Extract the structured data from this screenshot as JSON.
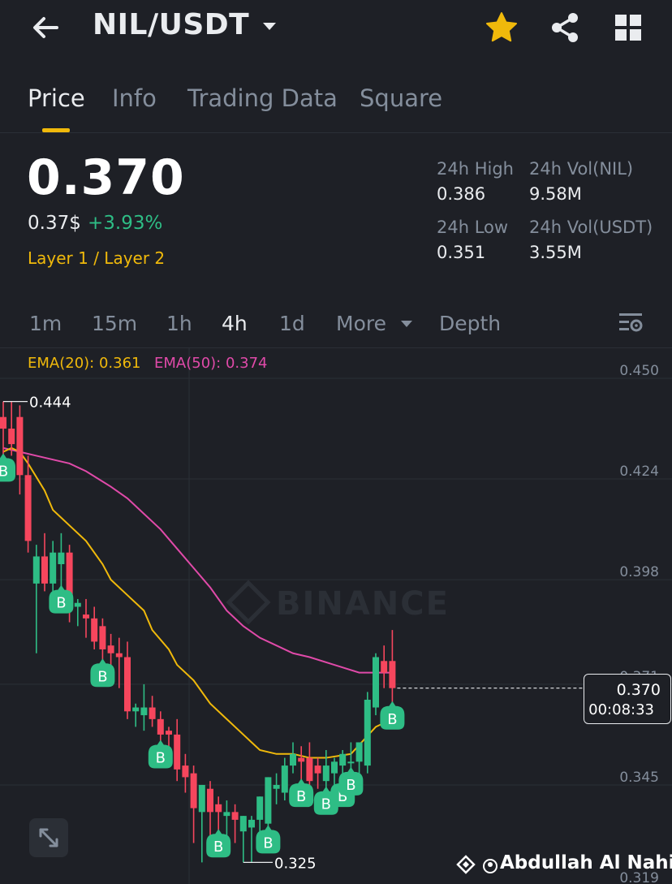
{
  "header": {
    "pair": "NIL/USDT",
    "icons": [
      "back-arrow-icon",
      "caret-down-icon",
      "star-icon",
      "share-icon",
      "grid-icon"
    ],
    "star_color": "#f0b90b"
  },
  "tabs": [
    {
      "label": "Price",
      "active": true
    },
    {
      "label": "Info",
      "active": false
    },
    {
      "label": "Trading Data",
      "active": false
    },
    {
      "label": "Square",
      "active": false
    }
  ],
  "price": {
    "last": "0.370",
    "usd": "0.37$",
    "change": "+3.93%",
    "category": "Layer 1 / Layer 2",
    "up_color": "#2ebd85",
    "down_color": "#f6465d"
  },
  "stats": {
    "high_label": "24h High",
    "high_value": "0.386",
    "vol_base_label": "24h Vol(NIL)",
    "vol_base_value": "9.58M",
    "low_label": "24h Low",
    "low_value": "0.351",
    "vol_quote_label": "24h Vol(USDT)",
    "vol_quote_value": "3.55M"
  },
  "timeframes": {
    "items": [
      "1m",
      "15m",
      "1h",
      "4h",
      "1d",
      "More",
      "Depth"
    ],
    "active": "4h"
  },
  "indicators": {
    "ema20": "EMA(20): 0.361",
    "ema50": "EMA(50): 0.374",
    "ema20_color": "#f0b90b",
    "ema50_color": "#e04aa9"
  },
  "chart_data": {
    "type": "candlestick",
    "y_ticks": [
      "0.450",
      "0.424",
      "0.398",
      "0.371",
      "0.345",
      "0.319"
    ],
    "y_range": [
      0.319,
      0.45
    ],
    "high_marker": "0.444",
    "low_marker": "0.325",
    "current_price": "0.370",
    "countdown": "00:08:33",
    "watermark": "BINANCE",
    "buy_marker_label": "B",
    "candles": [
      {
        "o": 0.44,
        "h": 0.444,
        "l": 0.43,
        "c": 0.437
      },
      {
        "o": 0.437,
        "h": 0.444,
        "l": 0.43,
        "c": 0.433
      },
      {
        "o": 0.44,
        "h": 0.443,
        "l": 0.42,
        "c": 0.425
      },
      {
        "o": 0.425,
        "h": 0.43,
        "l": 0.405,
        "c": 0.408
      },
      {
        "o": 0.397,
        "h": 0.407,
        "l": 0.379,
        "c": 0.404
      },
      {
        "o": 0.404,
        "h": 0.41,
        "l": 0.395,
        "c": 0.397
      },
      {
        "o": 0.397,
        "h": 0.408,
        "l": 0.39,
        "c": 0.405
      },
      {
        "o": 0.402,
        "h": 0.41,
        "l": 0.396,
        "c": 0.405
      },
      {
        "o": 0.405,
        "h": 0.407,
        "l": 0.387,
        "c": 0.39
      },
      {
        "o": 0.391,
        "h": 0.393,
        "l": 0.386,
        "c": 0.392
      },
      {
        "o": 0.389,
        "h": 0.393,
        "l": 0.383,
        "c": 0.388
      },
      {
        "o": 0.388,
        "h": 0.391,
        "l": 0.38,
        "c": 0.382
      },
      {
        "o": 0.386,
        "h": 0.388,
        "l": 0.377,
        "c": 0.38
      },
      {
        "o": 0.381,
        "h": 0.384,
        "l": 0.371,
        "c": 0.379
      },
      {
        "o": 0.379,
        "h": 0.383,
        "l": 0.37,
        "c": 0.378
      },
      {
        "o": 0.378,
        "h": 0.382,
        "l": 0.362,
        "c": 0.364
      },
      {
        "o": 0.364,
        "h": 0.366,
        "l": 0.36,
        "c": 0.365
      },
      {
        "o": 0.363,
        "h": 0.371,
        "l": 0.359,
        "c": 0.365
      },
      {
        "o": 0.365,
        "h": 0.368,
        "l": 0.36,
        "c": 0.362
      },
      {
        "o": 0.362,
        "h": 0.364,
        "l": 0.356,
        "c": 0.358
      },
      {
        "o": 0.359,
        "h": 0.36,
        "l": 0.353,
        "c": 0.358
      },
      {
        "o": 0.358,
        "h": 0.362,
        "l": 0.346,
        "c": 0.349
      },
      {
        "o": 0.35,
        "h": 0.353,
        "l": 0.343,
        "c": 0.347
      },
      {
        "o": 0.348,
        "h": 0.35,
        "l": 0.33,
        "c": 0.339
      },
      {
        "o": 0.338,
        "h": 0.345,
        "l": 0.325,
        "c": 0.345
      },
      {
        "o": 0.344,
        "h": 0.346,
        "l": 0.33,
        "c": 0.338
      },
      {
        "o": 0.34,
        "h": 0.342,
        "l": 0.333,
        "c": 0.338
      },
      {
        "o": 0.337,
        "h": 0.341,
        "l": 0.332,
        "c": 0.338
      },
      {
        "o": 0.338,
        "h": 0.34,
        "l": 0.33,
        "c": 0.336
      },
      {
        "o": 0.333,
        "h": 0.337,
        "l": 0.325,
        "c": 0.337
      },
      {
        "o": 0.334,
        "h": 0.337,
        "l": 0.325,
        "c": 0.336
      },
      {
        "o": 0.336,
        "h": 0.342,
        "l": 0.329,
        "c": 0.342
      },
      {
        "o": 0.335,
        "h": 0.347,
        "l": 0.334,
        "c": 0.347
      },
      {
        "o": 0.344,
        "h": 0.348,
        "l": 0.34,
        "c": 0.345
      },
      {
        "o": 0.343,
        "h": 0.352,
        "l": 0.341,
        "c": 0.35
      },
      {
        "o": 0.35,
        "h": 0.356,
        "l": 0.348,
        "c": 0.353
      },
      {
        "o": 0.352,
        "h": 0.355,
        "l": 0.346,
        "c": 0.351
      },
      {
        "o": 0.352,
        "h": 0.356,
        "l": 0.343,
        "c": 0.346
      },
      {
        "o": 0.35,
        "h": 0.352,
        "l": 0.344,
        "c": 0.348
      },
      {
        "o": 0.346,
        "h": 0.354,
        "l": 0.344,
        "c": 0.35
      },
      {
        "o": 0.348,
        "h": 0.352,
        "l": 0.343,
        "c": 0.351
      },
      {
        "o": 0.35,
        "h": 0.354,
        "l": 0.346,
        "c": 0.353
      },
      {
        "o": 0.351,
        "h": 0.356,
        "l": 0.349,
        "c": 0.351
      },
      {
        "o": 0.351,
        "h": 0.356,
        "l": 0.348,
        "c": 0.356
      },
      {
        "o": 0.35,
        "h": 0.369,
        "l": 0.348,
        "c": 0.367
      },
      {
        "o": 0.365,
        "h": 0.379,
        "l": 0.363,
        "c": 0.378
      },
      {
        "o": 0.377,
        "h": 0.381,
        "l": 0.37,
        "c": 0.374
      },
      {
        "o": 0.377,
        "h": 0.385,
        "l": 0.366,
        "c": 0.37
      }
    ],
    "buy_markers": [
      0,
      7,
      12,
      19,
      26,
      32,
      36,
      39,
      41,
      42,
      47
    ],
    "ema20": [
      0.431,
      0.432,
      0.431,
      0.428,
      0.421,
      0.416,
      0.412,
      0.408,
      0.402,
      0.398,
      0.394,
      0.39,
      0.385,
      0.38,
      0.376,
      0.372,
      0.366,
      0.362,
      0.358,
      0.356,
      0.354,
      0.353,
      0.353,
      0.352,
      0.352,
      0.353,
      0.36,
      0.362
    ],
    "ema20_x": [
      0,
      1,
      2,
      3,
      5,
      6,
      8,
      10,
      12,
      13,
      15,
      17,
      18,
      20,
      21,
      23,
      25,
      27,
      29,
      30,
      31,
      33,
      35,
      37,
      39,
      42,
      45,
      47
    ],
    "ema50": [
      0.432,
      0.431,
      0.43,
      0.429,
      0.428,
      0.426,
      0.422,
      0.419,
      0.415,
      0.411,
      0.406,
      0.401,
      0.396,
      0.39,
      0.386,
      0.383,
      0.381,
      0.379,
      0.378,
      0.376,
      0.374,
      0.374
    ],
    "ema50_x": [
      0,
      2,
      4,
      6,
      8,
      10,
      13,
      15,
      17,
      19,
      21,
      23,
      25,
      27,
      29,
      31,
      33,
      35,
      37,
      40,
      43,
      47
    ]
  },
  "footer": {
    "credit": "Abdullah Al Nahid"
  }
}
